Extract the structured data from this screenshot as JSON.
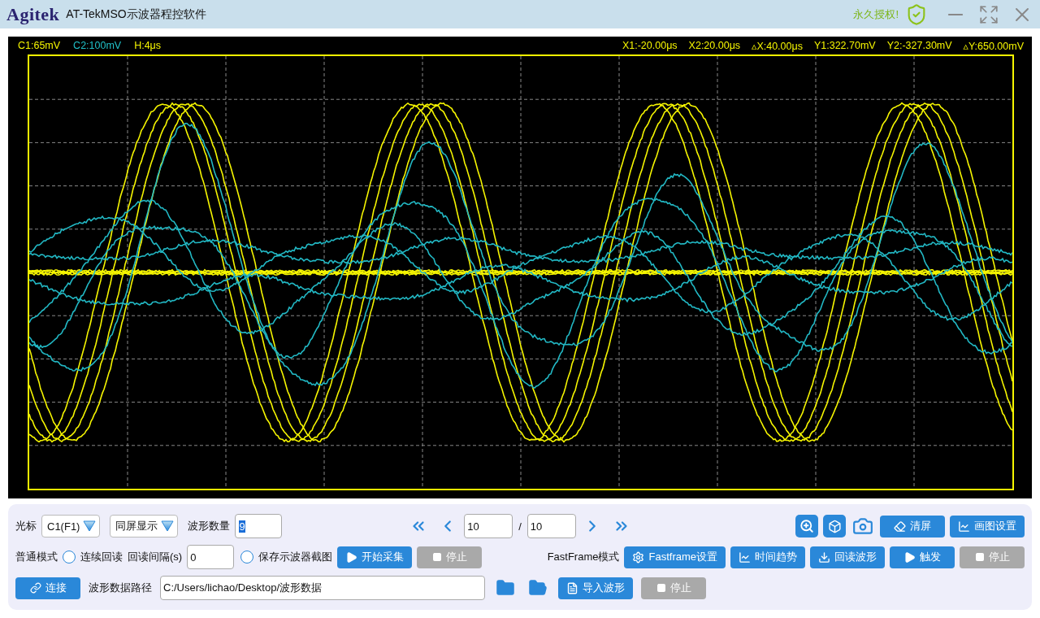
{
  "title_bar": {
    "logo": "Agitek",
    "title": "AT-TekMSO示波器程控软件",
    "license": "永久授权!"
  },
  "scope": {
    "readouts_left": [
      {
        "text": "C1:65mV",
        "color": "#f5f500"
      },
      {
        "text": "C2:100mV",
        "color": "#20c0c8"
      },
      {
        "text": "H:4μs",
        "color": "#f5f500"
      }
    ],
    "readouts_right": [
      "X1:-20.00μs",
      "X2:20.00μs",
      "▵X:40.00μs",
      "Y1:322.70mV",
      "Y2:-327.30mV",
      "▵Y:650.00mV"
    ]
  },
  "controls": {
    "row1": {
      "cursor_label": "光标",
      "cursor_select": "C1(F1)",
      "display_select": "同屏显示",
      "count_label": "波形数量",
      "count_value": "9",
      "count_value_highlighted": true,
      "pager": {
        "current": "10",
        "separator": "/",
        "total": "10"
      },
      "buttons": [
        {
          "label": "清屏",
          "kind": "eraser",
          "disabled": false
        },
        {
          "label": "画图设置",
          "kind": "chart",
          "disabled": false
        }
      ]
    },
    "row2": {
      "mode_label": "普通模式",
      "continuous": {
        "label": "连续回读",
        "selected": false
      },
      "interval_label": "回读间隔(s)",
      "interval_value": "0",
      "screenshot": {
        "label": "保存示波器截图",
        "selected": false
      },
      "left_buttons": [
        {
          "label": "开始采集",
          "kind": "play",
          "disabled": false
        },
        {
          "label": "停止",
          "kind": "stop",
          "disabled": true
        }
      ],
      "fastframe_label": "FastFrame模式",
      "right_buttons": [
        {
          "label": "Fastframe设置",
          "kind": "gear",
          "disabled": false
        },
        {
          "label": "时间趋势",
          "kind": "chart",
          "disabled": false
        },
        {
          "label": "回读波形",
          "kind": "download",
          "disabled": false
        },
        {
          "label": "触发",
          "kind": "play",
          "disabled": false
        },
        {
          "label": "停止",
          "kind": "stop",
          "disabled": true
        }
      ]
    },
    "row3": {
      "connect_button": {
        "label": "连接",
        "kind": "link",
        "disabled": false
      },
      "path_label": "波形数据路径",
      "path_value": "C:/Users/lichao/Desktop/波形数据",
      "buttons": [
        {
          "label": "导入波形",
          "kind": "csv",
          "disabled": false
        },
        {
          "label": "停止",
          "kind": "stop",
          "disabled": true
        }
      ]
    }
  }
}
